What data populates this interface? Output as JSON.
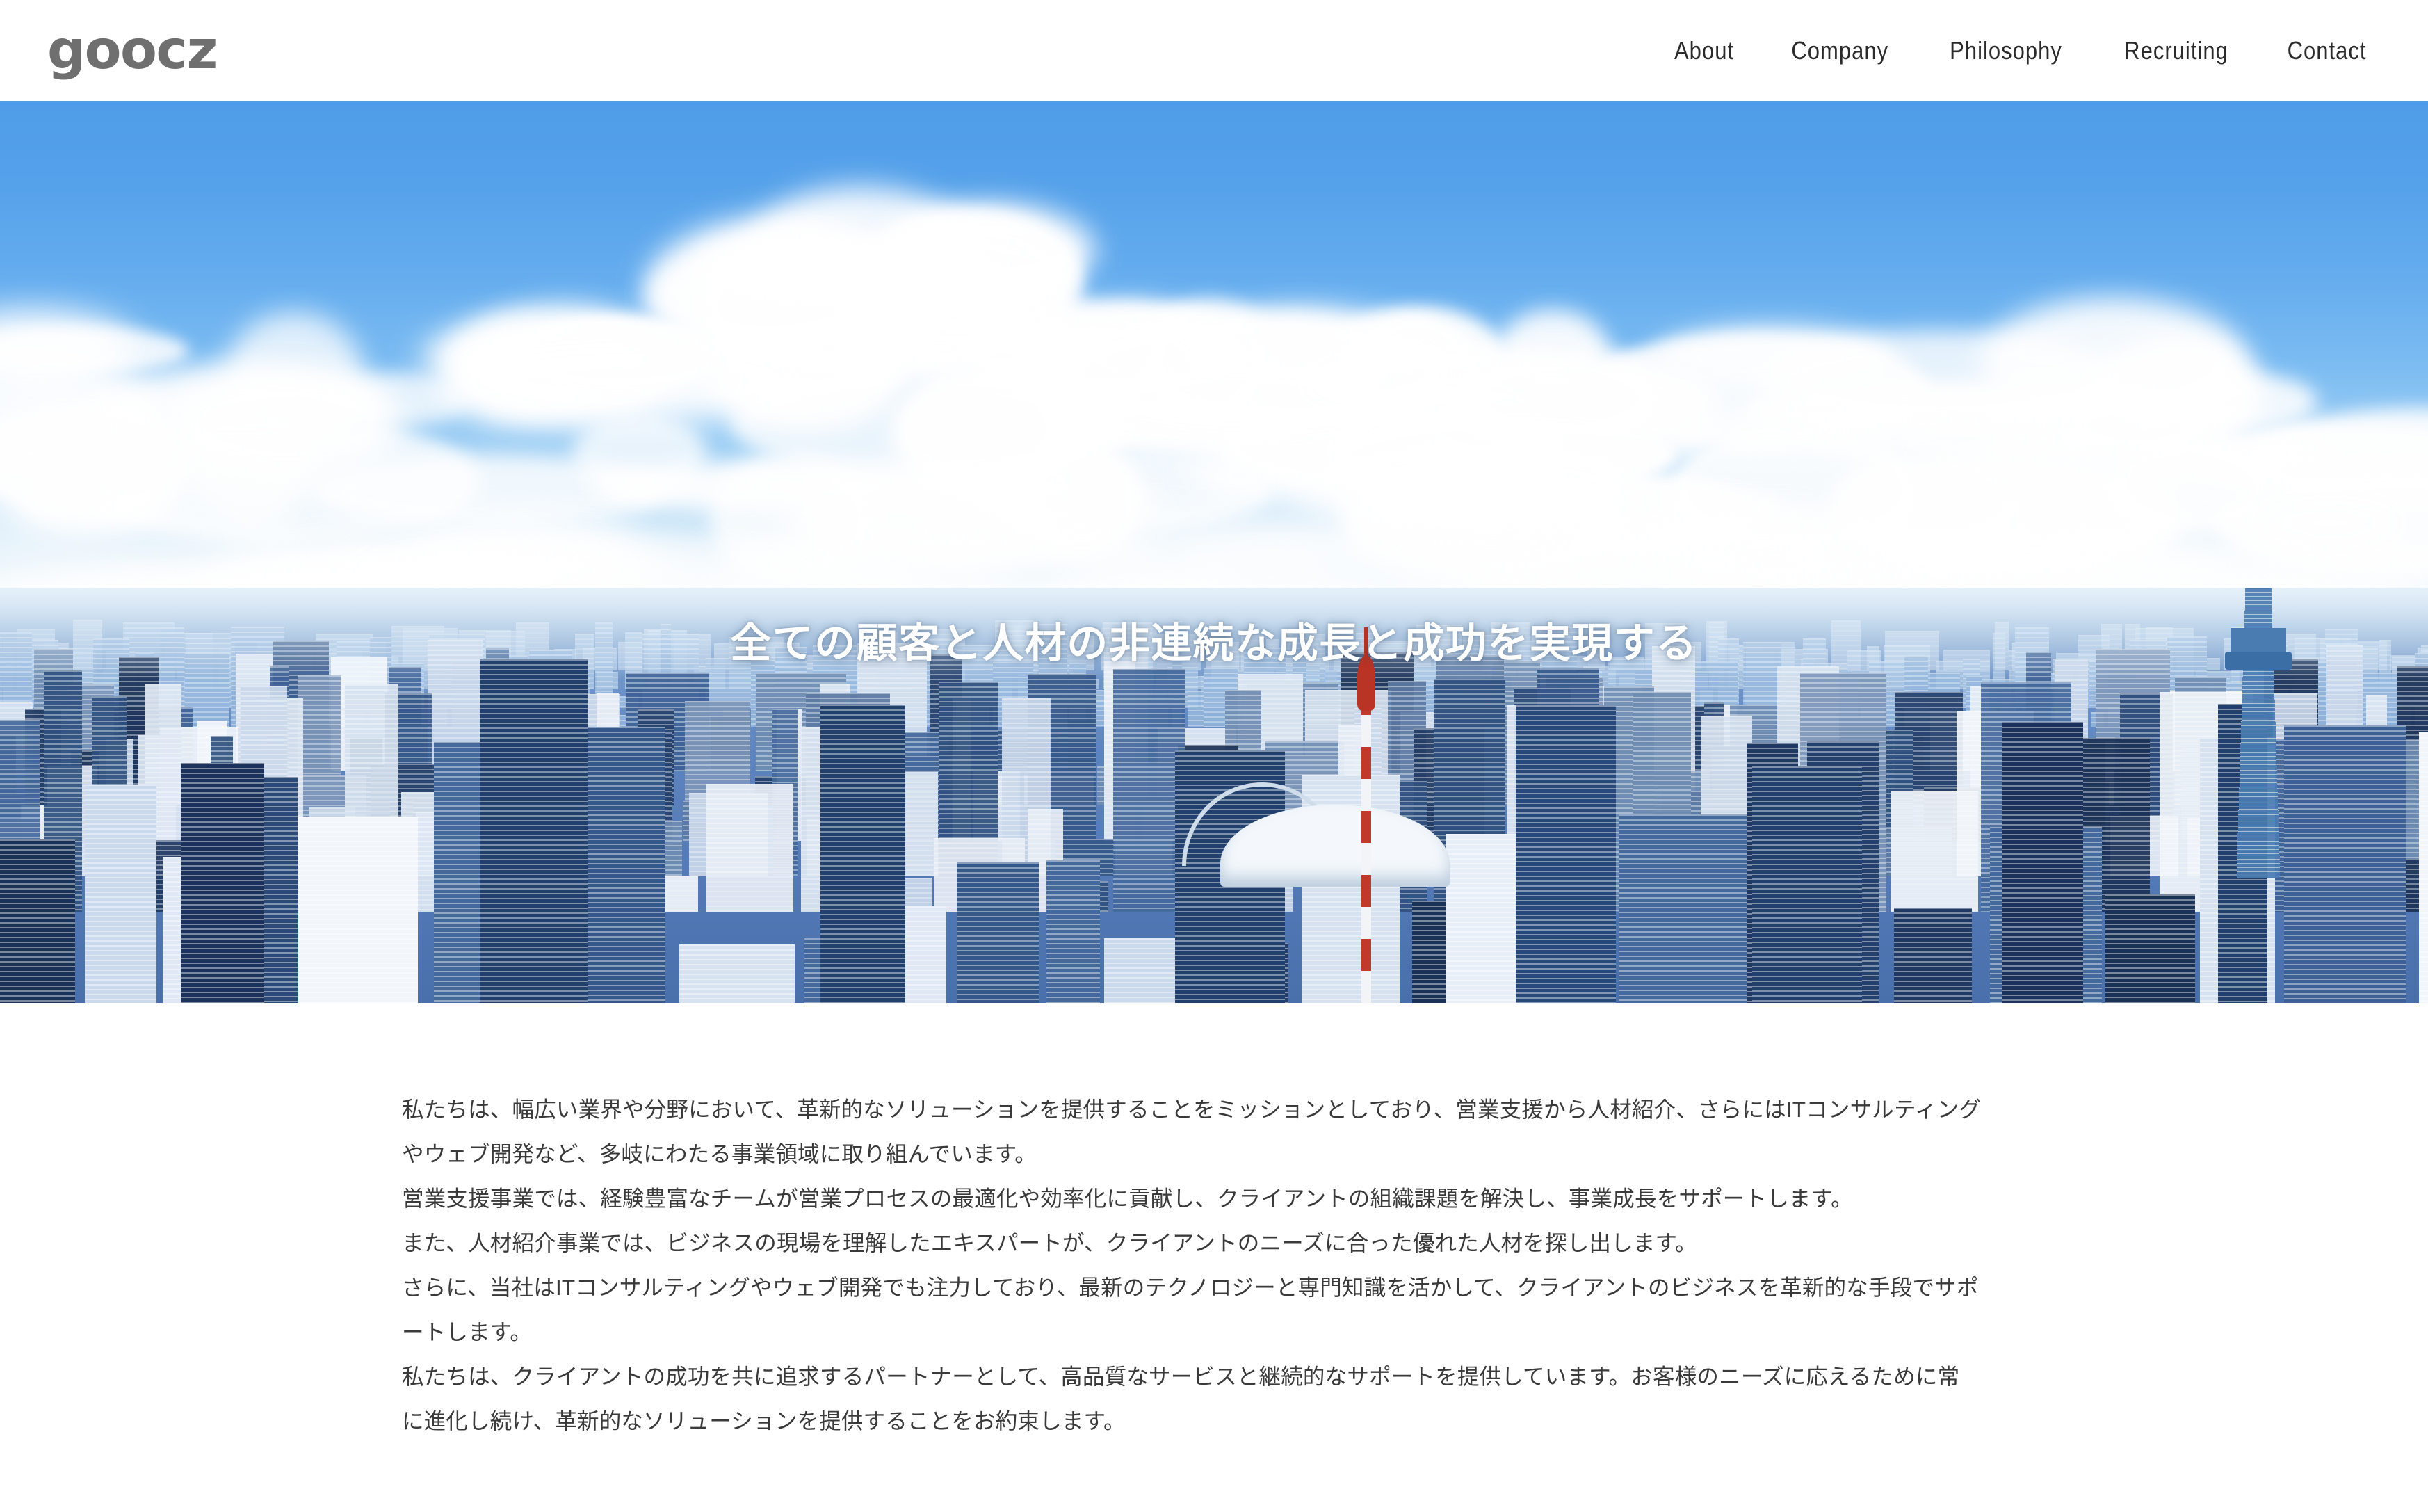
{
  "header": {
    "logo": "goocz",
    "nav": [
      {
        "label": "About"
      },
      {
        "label": "Company"
      },
      {
        "label": "Philosophy"
      },
      {
        "label": "Recruiting"
      },
      {
        "label": "Contact"
      }
    ]
  },
  "hero": {
    "headline": "全ての顧客と人材の非連続な成長と成功を実現する",
    "image_alt": "東京の都市風景（東京スカイツリー・東京ドーム）",
    "colors": {
      "sky_top": "#4f9ce8",
      "sky_bottom": "#e6f0f7",
      "city_base": "#4a70ac",
      "headline_color": "#ffffff"
    }
  },
  "about": {
    "lines": [
      "私たちは、幅広い業界や分野において、革新的なソリューションを提供することをミッションとしており、営業支援から人材紹介、さらにはITコンサルティング",
      "やウェブ開発など、多岐にわたる事業領域に取り組んでいます。",
      "営業支援事業では、経験豊富なチームが営業プロセスの最適化や効率化に貢献し、クライアントの組織課題を解決し、事業成長をサポートします。",
      "また、人材紹介事業では、ビジネスの現場を理解したエキスパートが、クライアントのニーズに合った優れた人材を探し出します。",
      "さらに、当社はITコンサルティングやウェブ開発でも注力しており、最新のテクノロジーと専門知識を活かして、クライアントのビジネスを革新的な手段でサポ",
      "ートします。",
      "私たちは、クライアントの成功を共に追求するパートナーとして、高品質なサービスと継続的なサポートを提供しています。お客様のニーズに応えるために常",
      "に進化し続け、革新的なソリューションを提供することをお約束します。"
    ]
  },
  "page": {
    "background": "#ffffff",
    "text_color": "#3a3a3a"
  }
}
